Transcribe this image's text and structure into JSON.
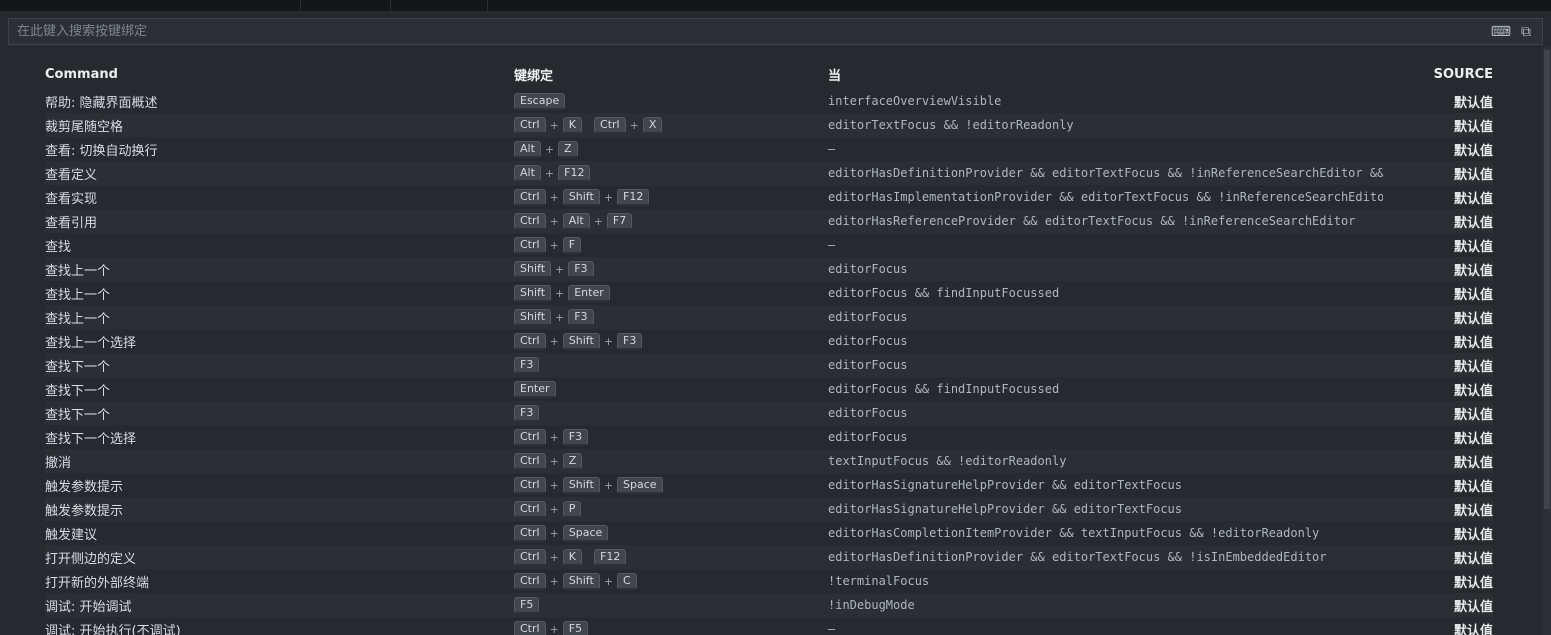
{
  "search": {
    "placeholder": "在此键入搜索按键绑定"
  },
  "icons": {
    "record_keys": "⌨",
    "open_json": "⧉"
  },
  "header": {
    "command": "Command",
    "keybinding": "键绑定",
    "when": "当",
    "source": "SOURCE"
  },
  "rows": [
    {
      "command": "帮助: 隐藏界面概述",
      "chords": [
        [
          "Escape"
        ]
      ],
      "when": "interfaceOverviewVisible",
      "source": "默认值"
    },
    {
      "command": "裁剪尾随空格",
      "chords": [
        [
          "Ctrl",
          "K"
        ],
        [
          "Ctrl",
          "X"
        ]
      ],
      "when": "editorTextFocus && !editorReadonly",
      "source": "默认值"
    },
    {
      "command": "查看: 切换自动换行",
      "chords": [
        [
          "Alt",
          "Z"
        ]
      ],
      "when": "—",
      "source": "默认值"
    },
    {
      "command": "查看定义",
      "chords": [
        [
          "Alt",
          "F12"
        ]
      ],
      "when": "editorHasDefinitionProvider && editorTextFocus && !inReferenceSearchEditor && !isInEmbeddedEdi…",
      "source": "默认值"
    },
    {
      "command": "查看实现",
      "chords": [
        [
          "Ctrl",
          "Shift",
          "F12"
        ]
      ],
      "when": "editorHasImplementationProvider && editorTextFocus && !inReferenceSearchEditor && !isInEmbedde…",
      "source": "默认值"
    },
    {
      "command": "查看引用",
      "chords": [
        [
          "Ctrl",
          "Alt",
          "F7"
        ]
      ],
      "when": "editorHasReferenceProvider && editorTextFocus && !inReferenceSearchEditor",
      "source": "默认值"
    },
    {
      "command": "查找",
      "chords": [
        [
          "Ctrl",
          "F"
        ]
      ],
      "when": "—",
      "source": "默认值"
    },
    {
      "command": "查找上一个",
      "chords": [
        [
          "Shift",
          "F3"
        ]
      ],
      "when": "editorFocus",
      "source": "默认值"
    },
    {
      "command": "查找上一个",
      "chords": [
        [
          "Shift",
          "Enter"
        ]
      ],
      "when": "editorFocus && findInputFocussed",
      "source": "默认值"
    },
    {
      "command": "查找上一个",
      "chords": [
        [
          "Shift",
          "F3"
        ]
      ],
      "when": "editorFocus",
      "source": "默认值"
    },
    {
      "command": "查找上一个选择",
      "chords": [
        [
          "Ctrl",
          "Shift",
          "F3"
        ]
      ],
      "when": "editorFocus",
      "source": "默认值"
    },
    {
      "command": "查找下一个",
      "chords": [
        [
          "F3"
        ]
      ],
      "when": "editorFocus",
      "source": "默认值"
    },
    {
      "command": "查找下一个",
      "chords": [
        [
          "Enter"
        ]
      ],
      "when": "editorFocus && findInputFocussed",
      "source": "默认值"
    },
    {
      "command": "查找下一个",
      "chords": [
        [
          "F3"
        ]
      ],
      "when": "editorFocus",
      "source": "默认值"
    },
    {
      "command": "查找下一个选择",
      "chords": [
        [
          "Ctrl",
          "F3"
        ]
      ],
      "when": "editorFocus",
      "source": "默认值"
    },
    {
      "command": "撤消",
      "chords": [
        [
          "Ctrl",
          "Z"
        ]
      ],
      "when": "textInputFocus && !editorReadonly",
      "source": "默认值"
    },
    {
      "command": "触发参数提示",
      "chords": [
        [
          "Ctrl",
          "Shift",
          "Space"
        ]
      ],
      "when": "editorHasSignatureHelpProvider && editorTextFocus",
      "source": "默认值"
    },
    {
      "command": "触发参数提示",
      "chords": [
        [
          "Ctrl",
          "P"
        ]
      ],
      "when": "editorHasSignatureHelpProvider && editorTextFocus",
      "source": "默认值"
    },
    {
      "command": "触发建议",
      "chords": [
        [
          "Ctrl",
          "Space"
        ]
      ],
      "when": "editorHasCompletionItemProvider && textInputFocus && !editorReadonly",
      "source": "默认值"
    },
    {
      "command": "打开侧边的定义",
      "chords": [
        [
          "Ctrl",
          "K"
        ],
        [
          "F12"
        ]
      ],
      "when": "editorHasDefinitionProvider && editorTextFocus && !isInEmbeddedEditor",
      "source": "默认值"
    },
    {
      "command": "打开新的外部终端",
      "chords": [
        [
          "Ctrl",
          "Shift",
          "C"
        ]
      ],
      "when": "!terminalFocus",
      "source": "默认值"
    },
    {
      "command": "调试: 开始调试",
      "chords": [
        [
          "F5"
        ]
      ],
      "when": "!inDebugMode",
      "source": "默认值"
    },
    {
      "command": "调试: 开始执行(不调试)",
      "chords": [
        [
          "Ctrl",
          "F5"
        ]
      ],
      "when": "—",
      "source": "默认值"
    }
  ]
}
